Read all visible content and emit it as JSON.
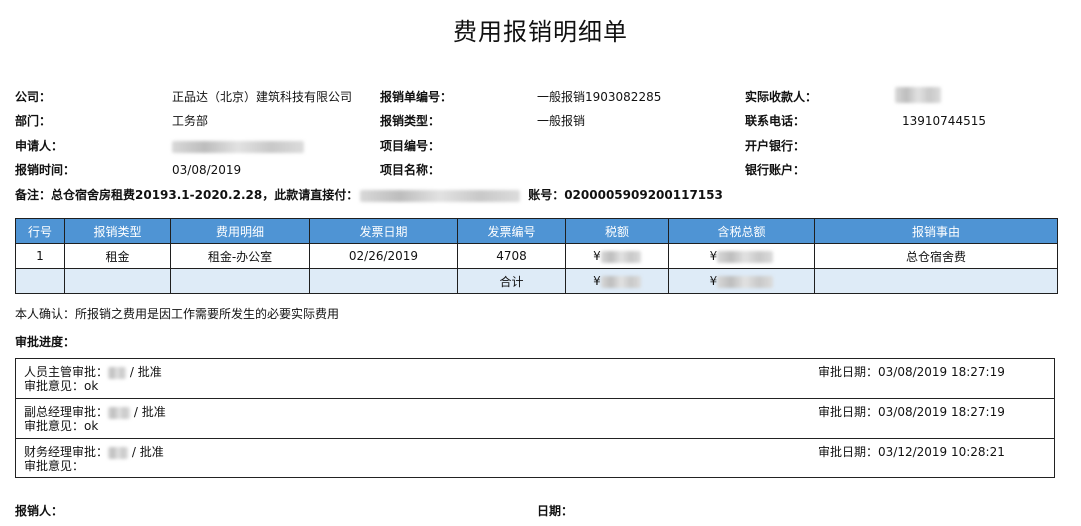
{
  "title": "费用报销明细单",
  "info": {
    "company_label": "公司：",
    "company_value": "正品达（北京）建筑科技有限公司",
    "dept_label": "部门：",
    "dept_value": "工务部",
    "applicant_label": "申请人：",
    "reimb_time_label": "报销时间：",
    "reimb_time_value": "03/08/2019",
    "doc_no_label": "报销单编号：",
    "doc_no_value": "一般报销1903082285",
    "type_label": "报销类型：",
    "type_value": "一般报销",
    "project_no_label": "项目编号：",
    "project_name_label": "项目名称：",
    "payee_label": "实际收款人：",
    "phone_label": "联系电话：",
    "phone_value": "13910744515",
    "bank_label": "开户银行：",
    "account_label": "银行账户："
  },
  "remark": {
    "prefix": "备注：总仓宿舍房租费20193.1-2020.2.28，此款请直接付：",
    "account_text": "账号：0200005909200117153"
  },
  "table": {
    "headers": [
      "行号",
      "报销类型",
      "费用明细",
      "发票日期",
      "发票编号",
      "税额",
      "含税总额",
      "报销事由"
    ],
    "row": {
      "no": "1",
      "type": "租金",
      "detail": "租金-办公室",
      "invoice_date": "02/26/2019",
      "invoice_no": "4708",
      "tax_prefix": "¥",
      "total_prefix": "¥",
      "reason": "总仓宿舍费"
    },
    "total": {
      "label": "合计",
      "tax_prefix": "¥",
      "total_prefix": "¥"
    }
  },
  "confirm": "本人确认：所报销之费用是因工作需要所发生的必要实际费用",
  "progress_label": "审批进度：",
  "approvals": [
    {
      "who": "人员主管审批：",
      "result": " / 批准",
      "opinion": "审批意见：ok",
      "date": "审批日期：03/08/2019 18:27:19"
    },
    {
      "who": "副总经理审批：",
      "result": " / 批准",
      "opinion": "审批意见：ok",
      "date": "审批日期：03/08/2019 18:27:19"
    },
    {
      "who": "财务经理审批：",
      "result": " / 批准",
      "opinion": "审批意见：",
      "date": "审批日期：03/12/2019 10:28:21"
    }
  ],
  "footer": {
    "reimburser_label": "报销人：",
    "date_label": "日期："
  }
}
